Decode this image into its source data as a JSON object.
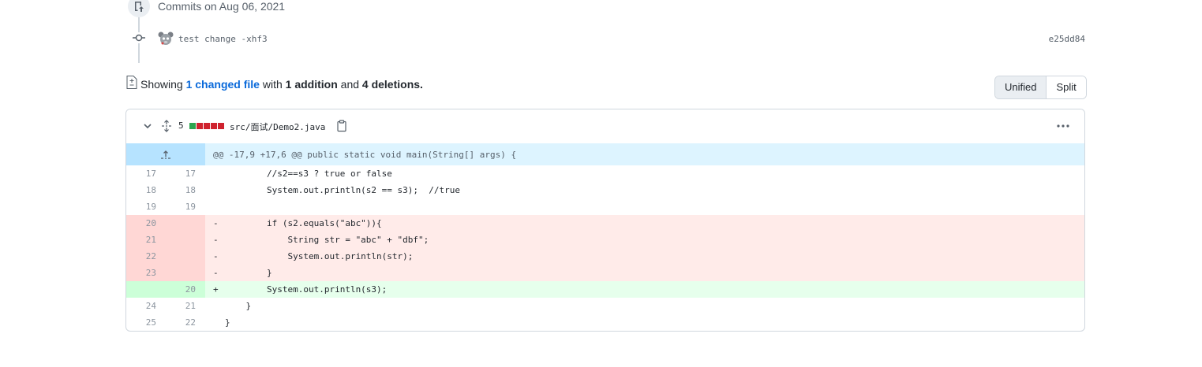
{
  "commits": {
    "heading": "Commits on Aug 06, 2021",
    "items": [
      {
        "message": "test change -xhf3",
        "sha": "e25dd84"
      }
    ]
  },
  "summary": {
    "prefix": "Showing",
    "changed_files": "1 changed file",
    "with": "with",
    "additions": "1 addition",
    "and": "and",
    "deletions": "4 deletions",
    "suffix": "."
  },
  "view_toggle": {
    "unified": "Unified",
    "split": "Split",
    "selected": "Unified"
  },
  "file": {
    "change_count": "5",
    "diffstat": [
      "add",
      "del",
      "del",
      "del",
      "del"
    ],
    "path": "src/面试/Demo2.java",
    "hunk_header": "@@ -17,9 +17,6 @@ public static void main(String[] args) {",
    "lines": [
      {
        "old": "17",
        "new": "17",
        "sign": "",
        "type": "ctx",
        "code": "        //s2==s3 ? true or false"
      },
      {
        "old": "18",
        "new": "18",
        "sign": "",
        "type": "ctx",
        "code": "        System.out.println(s2 == s3);  //true"
      },
      {
        "old": "19",
        "new": "19",
        "sign": "",
        "type": "ctx",
        "code": ""
      },
      {
        "old": "20",
        "new": "",
        "sign": "-",
        "type": "del",
        "code": "        if (s2.equals(\"abc\")){"
      },
      {
        "old": "21",
        "new": "",
        "sign": "-",
        "type": "del",
        "code": "            String str = \"abc\" + \"dbf\";"
      },
      {
        "old": "22",
        "new": "",
        "sign": "-",
        "type": "del",
        "code": "            System.out.println(str);"
      },
      {
        "old": "23",
        "new": "",
        "sign": "-",
        "type": "del",
        "code": "        }"
      },
      {
        "old": "",
        "new": "20",
        "sign": "+",
        "type": "add",
        "code": "        System.out.println(s3);"
      },
      {
        "old": "24",
        "new": "21",
        "sign": "",
        "type": "ctx",
        "code": "    }"
      },
      {
        "old": "25",
        "new": "22",
        "sign": "",
        "type": "ctx",
        "code": "}"
      }
    ]
  },
  "colors": {
    "addition": "#2da44e",
    "deletion": "#cf222e",
    "link": "#0969da"
  }
}
